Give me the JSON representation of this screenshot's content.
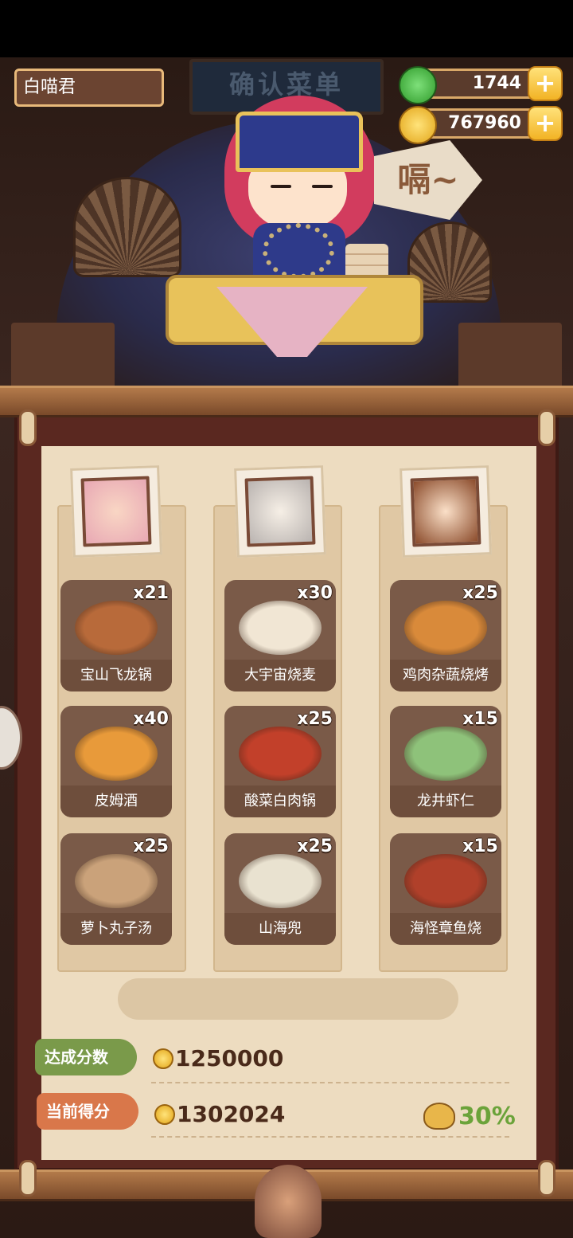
{
  "player": {
    "name": "白喵君"
  },
  "header": {
    "title": "确认菜单"
  },
  "resources": {
    "jade": {
      "icon": "jade-icon",
      "value": "1744"
    },
    "coins": {
      "icon": "coin-icon",
      "value": "767960"
    }
  },
  "scene": {
    "speech": "嗝~"
  },
  "columns": [
    {
      "portrait": "rabbit-hood-girl-portrait",
      "dishes": [
        {
          "name": "宝山飞龙锅",
          "count": "x21",
          "color": "#b86a3a"
        },
        {
          "name": "皮姆酒",
          "count": "x40",
          "color": "#e89a3a"
        },
        {
          "name": "萝卜丸子汤",
          "count": "x25",
          "color": "#caa27a"
        }
      ]
    },
    {
      "portrait": "white-hair-sage-portrait",
      "dishes": [
        {
          "name": "大宇宙烧麦",
          "count": "x30",
          "color": "#f1e6d4"
        },
        {
          "name": "酸菜白肉锅",
          "count": "x25",
          "color": "#c2402a"
        },
        {
          "name": "山海兜",
          "count": "x25",
          "color": "#e9e2d0"
        }
      ]
    },
    {
      "portrait": "horned-girl-portrait",
      "dishes": [
        {
          "name": "鸡肉杂蔬烧烤",
          "count": "x25",
          "color": "#d98a3a"
        },
        {
          "name": "龙井虾仁",
          "count": "x15",
          "color": "#8ec27a"
        },
        {
          "name": "海怪章鱼烧",
          "count": "x15",
          "color": "#b0402a"
        }
      ]
    }
  ],
  "scores": {
    "target_label": "达成分数",
    "target_value": "1250000",
    "current_label": "当前得分",
    "current_value": "1302024",
    "bonus_percent": "30%"
  },
  "colors": {
    "target_tag": "#7a9a4a",
    "current_tag": "#d9774a",
    "bonus": "#6ba33a"
  }
}
